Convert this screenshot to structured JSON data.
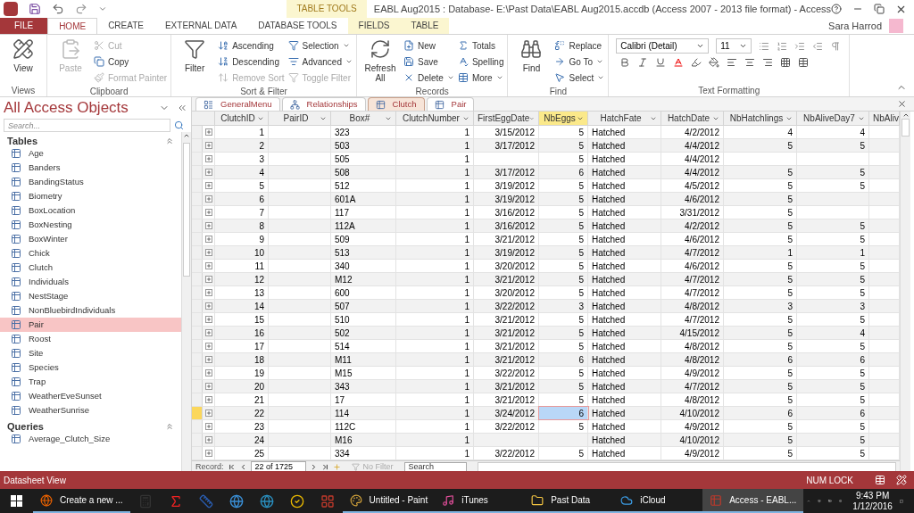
{
  "window": {
    "title": "EABL Aug2015 : Database- E:\\Past Data\\EABL Aug2015.accdb (Access 2007 - 2013 file format) - Access",
    "user": "Sara Harrod"
  },
  "ribbon": {
    "context_header": "TABLE TOOLS",
    "tabs": [
      {
        "label": "FILE",
        "kind": "file",
        "selected": false
      },
      {
        "label": "HOME",
        "kind": "tab",
        "selected": true
      },
      {
        "label": "CREATE",
        "kind": "tab",
        "selected": false
      },
      {
        "label": "EXTERNAL DATA",
        "kind": "tab",
        "selected": false
      },
      {
        "label": "DATABASE TOOLS",
        "kind": "tab",
        "selected": false
      },
      {
        "label": "FIELDS",
        "kind": "context",
        "selected": false
      },
      {
        "label": "TABLE",
        "kind": "context",
        "selected": false
      }
    ],
    "groups": [
      {
        "label": "Views",
        "large": [
          {
            "label": "View",
            "disabled": false
          }
        ]
      },
      {
        "label": "Clipboard",
        "large": [
          {
            "label": "Paste",
            "disabled": true
          }
        ],
        "small": [
          [
            {
              "label": "Cut",
              "disabled": true
            },
            {
              "label": "Copy",
              "disabled": false
            },
            {
              "label": "Format Painter",
              "disabled": true
            }
          ]
        ]
      },
      {
        "label": "Sort & Filter",
        "large": [
          {
            "label": "Filter",
            "disabled": false
          }
        ],
        "small": [
          [
            {
              "label": "Ascending",
              "disabled": false
            },
            {
              "label": "Descending",
              "disabled": false
            },
            {
              "label": "Remove Sort",
              "disabled": true
            }
          ],
          [
            {
              "label": "Selection",
              "disabled": false
            },
            {
              "label": "Advanced",
              "disabled": false
            },
            {
              "label": "Toggle Filter",
              "disabled": true
            }
          ]
        ]
      },
      {
        "label": "Records",
        "large": [
          {
            "label": "Refresh All",
            "disabled": false
          }
        ],
        "small": [
          [
            {
              "label": "New",
              "disabled": false
            },
            {
              "label": "Save",
              "disabled": false
            },
            {
              "label": "Delete",
              "disabled": false
            }
          ],
          [
            {
              "label": "Totals",
              "disabled": false
            },
            {
              "label": "Spelling",
              "disabled": false
            },
            {
              "label": "More",
              "disabled": false
            }
          ]
        ]
      },
      {
        "label": "Find",
        "large": [
          {
            "label": "Find",
            "disabled": false
          }
        ],
        "small": [
          [
            {
              "label": "Replace",
              "disabled": false
            },
            {
              "label": "Go To",
              "disabled": false
            },
            {
              "label": "Select",
              "disabled": false
            }
          ]
        ]
      }
    ],
    "text_formatting": {
      "label": "Text Formatting",
      "font": "Calibri (Detail)",
      "size": "11"
    }
  },
  "navigation": {
    "title": "All Access Objects",
    "search": {
      "placeholder": "Search..."
    },
    "groups": [
      {
        "label": "Tables",
        "expanded": true,
        "items": [
          {
            "label": "Age",
            "selected": false
          },
          {
            "label": "Banders",
            "selected": false
          },
          {
            "label": "BandingStatus",
            "selected": false
          },
          {
            "label": "Biometry",
            "selected": false
          },
          {
            "label": "BoxLocation",
            "selected": false
          },
          {
            "label": "BoxNesting",
            "selected": false
          },
          {
            "label": "BoxWinter",
            "selected": false
          },
          {
            "label": "Chick",
            "selected": false
          },
          {
            "label": "Clutch",
            "selected": false
          },
          {
            "label": "Individuals",
            "selected": false
          },
          {
            "label": "NestStage",
            "selected": false
          },
          {
            "label": "NonBluebirdIndividuals",
            "selected": false
          },
          {
            "label": "Pair",
            "selected": true
          },
          {
            "label": "Roost",
            "selected": false
          },
          {
            "label": "Site",
            "selected": false
          },
          {
            "label": "Species",
            "selected": false
          },
          {
            "label": "Trap",
            "selected": false
          },
          {
            "label": "WeatherEveSunset",
            "selected": false
          },
          {
            "label": "WeatherSunrise",
            "selected": false
          }
        ]
      },
      {
        "label": "Queries",
        "expanded": true,
        "items": [
          {
            "label": "Average_Clutch_Size",
            "selected": false
          }
        ]
      }
    ]
  },
  "document_tabs": [
    {
      "label": "GeneralMenu",
      "kind": "form",
      "selected": false
    },
    {
      "label": "Relationships",
      "kind": "relationships",
      "selected": false
    },
    {
      "label": "Clutch",
      "kind": "table",
      "selected": true
    },
    {
      "label": "Pair",
      "kind": "table",
      "selected": false
    }
  ],
  "table": {
    "columns": [
      {
        "label": "ClutchID",
        "selected": false
      },
      {
        "label": "PairID",
        "selected": false
      },
      {
        "label": "Box#",
        "selected": false
      },
      {
        "label": "ClutchNumber",
        "selected": false
      },
      {
        "label": "FirstEggDate",
        "selected": false
      },
      {
        "label": "NbEggs",
        "selected": true
      },
      {
        "label": "HatchFate",
        "selected": false
      },
      {
        "label": "HatchDate",
        "selected": false
      },
      {
        "label": "NbHatchlings",
        "selected": false
      },
      {
        "label": "NbAliveDay7",
        "selected": false
      },
      {
        "label": "NbAliv",
        "selected": false
      }
    ],
    "rows": [
      {
        "selected": false,
        "cells": [
          "1",
          null,
          "323",
          "1",
          "3/15/2012",
          "5",
          "Hatched",
          "4/2/2012",
          "4",
          "4",
          null
        ]
      },
      {
        "selected": false,
        "cells": [
          "2",
          null,
          "503",
          "1",
          "3/17/2012",
          "5",
          "Hatched",
          "4/4/2012",
          "5",
          "5",
          null
        ]
      },
      {
        "selected": false,
        "cells": [
          "3",
          null,
          "505",
          "1",
          null,
          "5",
          "Hatched",
          "4/4/2012",
          null,
          null,
          null
        ]
      },
      {
        "selected": false,
        "cells": [
          "4",
          null,
          "508",
          "1",
          "3/17/2012",
          "6",
          "Hatched",
          "4/4/2012",
          "5",
          "5",
          null
        ]
      },
      {
        "selected": false,
        "cells": [
          "5",
          null,
          "512",
          "1",
          "3/19/2012",
          "5",
          "Hatched",
          "4/5/2012",
          "5",
          "5",
          null
        ]
      },
      {
        "selected": false,
        "cells": [
          "6",
          null,
          "601A",
          "1",
          "3/19/2012",
          "5",
          "Hatched",
          "4/6/2012",
          "5",
          null,
          null
        ]
      },
      {
        "selected": false,
        "cells": [
          "7",
          null,
          "117",
          "1",
          "3/16/2012",
          "5",
          "Hatched",
          "3/31/2012",
          "5",
          null,
          null
        ]
      },
      {
        "selected": false,
        "cells": [
          "8",
          null,
          "112A",
          "1",
          "3/16/2012",
          "5",
          "Hatched",
          "4/2/2012",
          "5",
          "5",
          null
        ]
      },
      {
        "selected": false,
        "cells": [
          "9",
          null,
          "509",
          "1",
          "3/21/2012",
          "5",
          "Hatched",
          "4/6/2012",
          "5",
          "5",
          null
        ]
      },
      {
        "selected": false,
        "cells": [
          "10",
          null,
          "513",
          "1",
          "3/19/2012",
          "5",
          "Hatched",
          "4/7/2012",
          "1",
          "1",
          null
        ]
      },
      {
        "selected": false,
        "cells": [
          "11",
          null,
          "340",
          "1",
          "3/20/2012",
          "5",
          "Hatched",
          "4/6/2012",
          "5",
          "5",
          null
        ]
      },
      {
        "selected": false,
        "cells": [
          "12",
          null,
          "M12",
          "1",
          "3/21/2012",
          "5",
          "Hatched",
          "4/7/2012",
          "5",
          "5",
          null
        ]
      },
      {
        "selected": false,
        "cells": [
          "13",
          null,
          "600",
          "1",
          "3/20/2012",
          "5",
          "Hatched",
          "4/7/2012",
          "5",
          "5",
          null
        ]
      },
      {
        "selected": false,
        "cells": [
          "14",
          null,
          "507",
          "1",
          "3/22/2012",
          "3",
          "Hatched",
          "4/8/2012",
          "3",
          "3",
          null
        ]
      },
      {
        "selected": false,
        "cells": [
          "15",
          null,
          "510",
          "1",
          "3/21/2012",
          "5",
          "Hatched",
          "4/7/2012",
          "5",
          "5",
          null
        ]
      },
      {
        "selected": false,
        "cells": [
          "16",
          null,
          "502",
          "1",
          "3/21/2012",
          "5",
          "Hatched",
          "4/15/2012",
          "5",
          "4",
          null
        ]
      },
      {
        "selected": false,
        "cells": [
          "17",
          null,
          "514",
          "1",
          "3/21/2012",
          "5",
          "Hatched",
          "4/8/2012",
          "5",
          "5",
          null
        ]
      },
      {
        "selected": false,
        "cells": [
          "18",
          null,
          "M11",
          "1",
          "3/21/2012",
          "6",
          "Hatched",
          "4/8/2012",
          "6",
          "6",
          null
        ]
      },
      {
        "selected": false,
        "cells": [
          "19",
          null,
          "M15",
          "1",
          "3/22/2012",
          "5",
          "Hatched",
          "4/9/2012",
          "5",
          "5",
          null
        ]
      },
      {
        "selected": false,
        "cells": [
          "20",
          null,
          "343",
          "1",
          "3/21/2012",
          "5",
          "Hatched",
          "4/7/2012",
          "5",
          "5",
          null
        ]
      },
      {
        "selected": false,
        "cells": [
          "21",
          null,
          "17",
          "1",
          "3/21/2012",
          "5",
          "Hatched",
          "4/8/2012",
          "5",
          "5",
          null
        ]
      },
      {
        "selected": true,
        "cells": [
          "22",
          null,
          "114",
          "1",
          "3/24/2012",
          "6",
          "Hatched",
          "4/10/2012",
          "6",
          "6",
          null
        ]
      },
      {
        "selected": false,
        "cells": [
          "23",
          null,
          "112C",
          "1",
          "3/22/2012",
          "5",
          "Hatched",
          "4/9/2012",
          "5",
          "5",
          null
        ]
      },
      {
        "selected": false,
        "cells": [
          "24",
          null,
          "M16",
          "1",
          null,
          null,
          "Hatched",
          "4/10/2012",
          "5",
          "5",
          null
        ]
      },
      {
        "selected": false,
        "cells": [
          "25",
          null,
          "334",
          "1",
          "3/22/2012",
          "5",
          "Hatched",
          "4/9/2012",
          "5",
          "5",
          null
        ]
      }
    ]
  },
  "record_navigator": {
    "label": "Record:",
    "position": "22 of 1725",
    "filter": "No Filter",
    "search": {
      "placeholder": "Search"
    }
  },
  "status_bar": {
    "view": "Datasheet View",
    "indicator": "NUM LOCK"
  },
  "taskbar": {
    "items": [
      {
        "label": "Create a new ...",
        "kind": "browser",
        "selected": false
      },
      {
        "label": "Untitled - Paint",
        "kind": "paint",
        "selected": false
      },
      {
        "label": "iTunes",
        "kind": "music",
        "selected": false
      },
      {
        "label": "Past Data",
        "kind": "folder",
        "selected": false
      },
      {
        "label": "iCloud",
        "kind": "cloud",
        "selected": false
      },
      {
        "label": "Access - EABL...",
        "kind": "access",
        "selected": true
      }
    ],
    "time": "9:43 PM",
    "date": "1/12/2016"
  }
}
